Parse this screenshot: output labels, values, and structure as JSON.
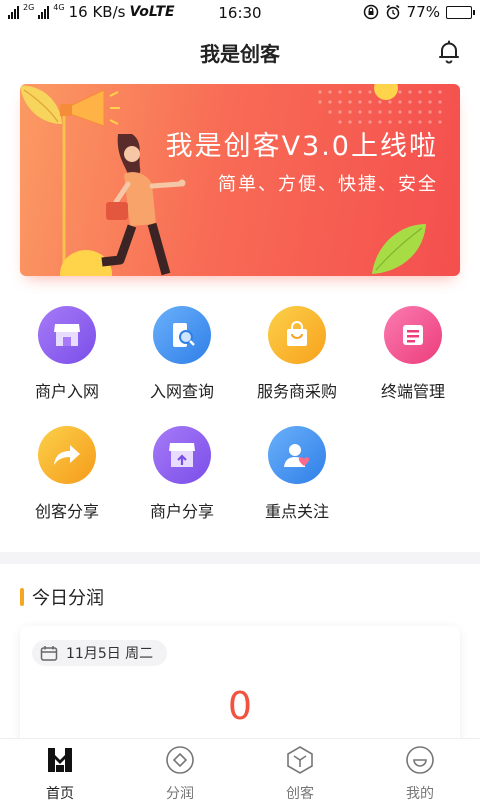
{
  "status_bar": {
    "network_top": "2G",
    "network_sub": "4G",
    "speed": "16 KB/s",
    "volte": "VoLTE",
    "time": "16:30",
    "battery": "77%",
    "battery_level": 0.77
  },
  "header": {
    "title": "我是创客",
    "notification_icon": "bell-icon"
  },
  "banner": {
    "title": "我是创客V3.0上线啦",
    "subtitle": "简单、方便、快捷、安全"
  },
  "grid": {
    "items": [
      {
        "label": "商户入网",
        "icon": "store-icon",
        "color": "#8a5cf0"
      },
      {
        "label": "入网查询",
        "icon": "phone-search-icon",
        "color": "#3d8ff0"
      },
      {
        "label": "服务商采购",
        "icon": "shopping-bag-icon",
        "color": "#f8b320"
      },
      {
        "label": "终端管理",
        "icon": "terminal-icon",
        "color": "#f2558a"
      },
      {
        "label": "创客分享",
        "icon": "share-arrow-icon",
        "color": "#f5a623"
      },
      {
        "label": "商户分享",
        "icon": "store-share-icon",
        "color": "#8a5cf0"
      },
      {
        "label": "重点关注",
        "icon": "user-heart-icon",
        "color": "#3d8ff0"
      }
    ]
  },
  "profit": {
    "section_title": "今日分润",
    "date": "11月5日 周二",
    "value": "0"
  },
  "tabbar": {
    "tabs": [
      {
        "label": "首页",
        "icon": "home-logo-icon",
        "active": true
      },
      {
        "label": "分润",
        "icon": "diamond-coin-icon",
        "active": false
      },
      {
        "label": "创客",
        "icon": "maker-hexagon-icon",
        "active": false
      },
      {
        "label": "我的",
        "icon": "smile-face-icon",
        "active": false
      }
    ]
  },
  "colors": {
    "accent": "#f2523f",
    "banner_start": "#fb9a63",
    "banner_end": "#f44f4e",
    "section_bar": "#f5a623"
  }
}
